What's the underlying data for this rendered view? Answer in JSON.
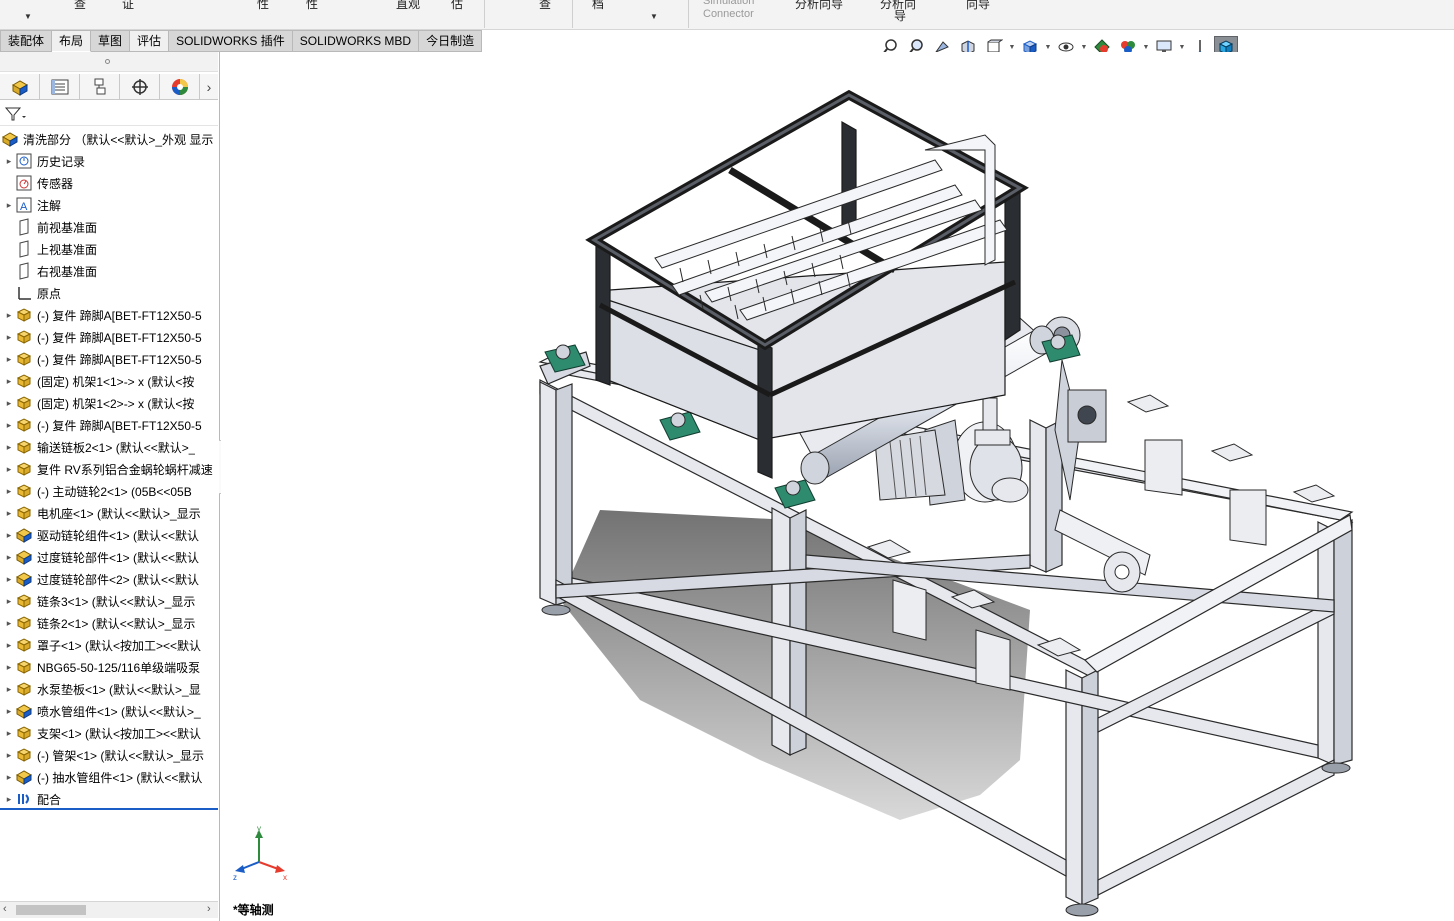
{
  "ribbon": {
    "items": [
      "查",
      "证",
      "性",
      "性",
      "直观",
      "估",
      "查",
      "档",
      "分析向导",
      "分析向",
      "导",
      "向导"
    ],
    "simulation_line1": "Simulation",
    "simulation_line2": "Connector"
  },
  "tabs": [
    {
      "label": "装配体"
    },
    {
      "label": "布局"
    },
    {
      "label": "草图"
    },
    {
      "label": "评估"
    },
    {
      "label": "SOLIDWORKS 插件"
    },
    {
      "label": "SOLIDWORKS MBD"
    },
    {
      "label": "今日制造"
    }
  ],
  "active_tab": "布局",
  "feature_tree": {
    "root": "清洗部分 （默认<<默认>_外观 显示",
    "nodes": [
      {
        "label": "历史记录",
        "icon": "history-icon",
        "expand": true
      },
      {
        "label": "传感器",
        "icon": "sensor-icon",
        "expand": false
      },
      {
        "label": "注解",
        "icon": "annotation-icon",
        "expand": true
      },
      {
        "label": "前视基准面",
        "icon": "plane-icon",
        "expand": false
      },
      {
        "label": "上视基准面",
        "icon": "plane-icon",
        "expand": false
      },
      {
        "label": "右视基准面",
        "icon": "plane-icon",
        "expand": false
      },
      {
        "label": "原点",
        "icon": "origin-icon",
        "expand": false
      },
      {
        "label": "(-) 复件 蹄脚A[BET-FT12X50-5",
        "icon": "part-icon",
        "expand": true
      },
      {
        "label": "(-) 复件 蹄脚A[BET-FT12X50-5",
        "icon": "part-icon",
        "expand": true
      },
      {
        "label": "(-) 复件 蹄脚A[BET-FT12X50-5",
        "icon": "part-icon",
        "expand": true
      },
      {
        "label": "(固定) 机架1<1>-> x (默认<按",
        "icon": "part-icon",
        "expand": true
      },
      {
        "label": "(固定) 机架1<2>-> x (默认<按",
        "icon": "part-icon",
        "expand": true
      },
      {
        "label": "(-) 复件 蹄脚A[BET-FT12X50-5",
        "icon": "part-icon",
        "expand": true
      },
      {
        "label": "输送链板2<1> (默认<<默认>_",
        "icon": "part-icon",
        "expand": true
      },
      {
        "label": "复件 RV系列铝合金蜗轮蜗杆减速",
        "icon": "part-icon",
        "expand": true
      },
      {
        "label": "(-) 主动链轮2<1> (05B<<05B",
        "icon": "part-icon",
        "expand": true
      },
      {
        "label": "电机座<1> (默认<<默认>_显示",
        "icon": "part-icon",
        "expand": true
      },
      {
        "label": "驱动链轮组件<1> (默认<<默认",
        "icon": "assembly-icon",
        "expand": true
      },
      {
        "label": "过度链轮部件<1> (默认<<默认",
        "icon": "assembly-icon",
        "expand": true
      },
      {
        "label": "过度链轮部件<2> (默认<<默认",
        "icon": "assembly-icon",
        "expand": true
      },
      {
        "label": "链条3<1> (默认<<默认>_显示",
        "icon": "part-icon",
        "expand": true
      },
      {
        "label": "链条2<1> (默认<<默认>_显示",
        "icon": "part-icon",
        "expand": true
      },
      {
        "label": "罩子<1> (默认<按加工><<默认",
        "icon": "part-icon",
        "expand": true
      },
      {
        "label": "NBG65-50-125/116单级端吸泵",
        "icon": "part-icon",
        "expand": true
      },
      {
        "label": "水泵垫板<1> (默认<<默认>_显",
        "icon": "part-icon",
        "expand": true
      },
      {
        "label": "喷水管组件<1> (默认<<默认>_",
        "icon": "assembly-icon",
        "expand": true
      },
      {
        "label": "支架<1> (默认<按加工><<默认",
        "icon": "part-icon",
        "expand": true
      },
      {
        "label": "(-) 管架<1> (默认<<默认>_显示",
        "icon": "part-icon",
        "expand": true
      },
      {
        "label": "(-) 抽水管组件<1> (默认<<默认",
        "icon": "assembly-icon",
        "expand": true
      },
      {
        "label": "配合",
        "icon": "mates-icon",
        "expand": true
      }
    ]
  },
  "view": {
    "name": "*等轴测",
    "triad": {
      "x": "x",
      "y": "y",
      "z": "z"
    }
  },
  "colors": {
    "frame": "#e6e8ee",
    "frame_edge": "#2a2a2a",
    "bearing": "#2e8b6e",
    "part_yellow": "#f2c84b",
    "accent_blue": "#1a5dc7"
  }
}
